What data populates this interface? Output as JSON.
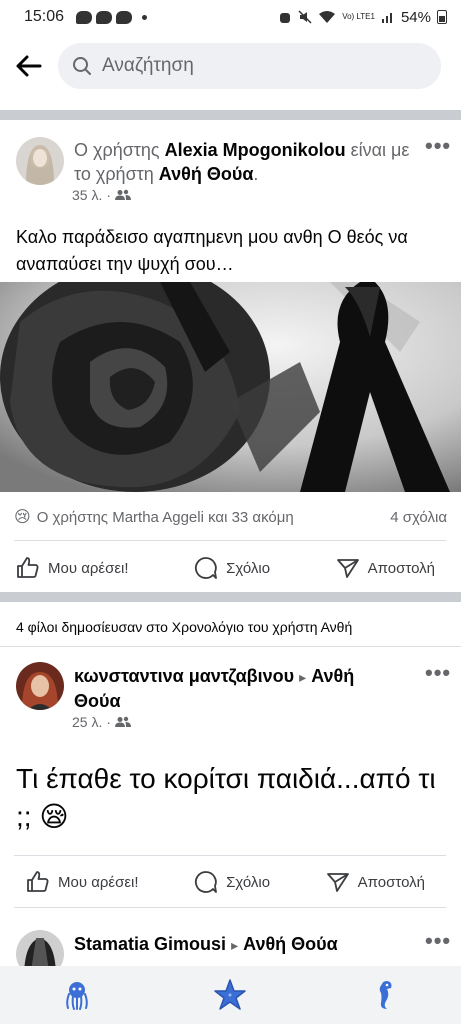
{
  "status_bar": {
    "time": "15:06",
    "lte": "Vo) LTE1",
    "battery": "54%"
  },
  "search": {
    "placeholder": "Αναζήτηση"
  },
  "post1": {
    "prefix": "Ο χρήστης ",
    "author": "Alexia Mpogonikolou",
    "middle": " είναι με το χρήστη ",
    "tagged": "Ανθή Θούα",
    "suffix": ".",
    "time": "35 λ.",
    "text": "Καλο παράδεισο αγαπημενη μου ανθη  Ο θεός να αναπαύσει την ψυχή σου…",
    "reactions": "Ο χρήστης Martha Aggeli και 33 ακόμη",
    "comments": "4 σχόλια"
  },
  "actions": {
    "like": "Μου αρέσει!",
    "comment": "Σχόλιο",
    "share": "Αποστολή"
  },
  "friends_note": "4 φίλοι δημοσίευσαν στο Χρονολόγιο του χρήστη Ανθή",
  "post2": {
    "author": "κωνσταντινα μαντζαβινου",
    "arrow": "▸",
    "target": "Ανθή Θούα",
    "time": "25 λ.",
    "text": "Τι έπαθε το κορίτσι παιδιά...από τι ;;"
  },
  "post3": {
    "author": "Stamatia Gimousi",
    "arrow": "▸",
    "target": "Ανθή Θούα"
  },
  "colors": {
    "separator": "#c9ccd1",
    "nav_icon": "#3b6fd6",
    "muted_text": "#65676b"
  }
}
